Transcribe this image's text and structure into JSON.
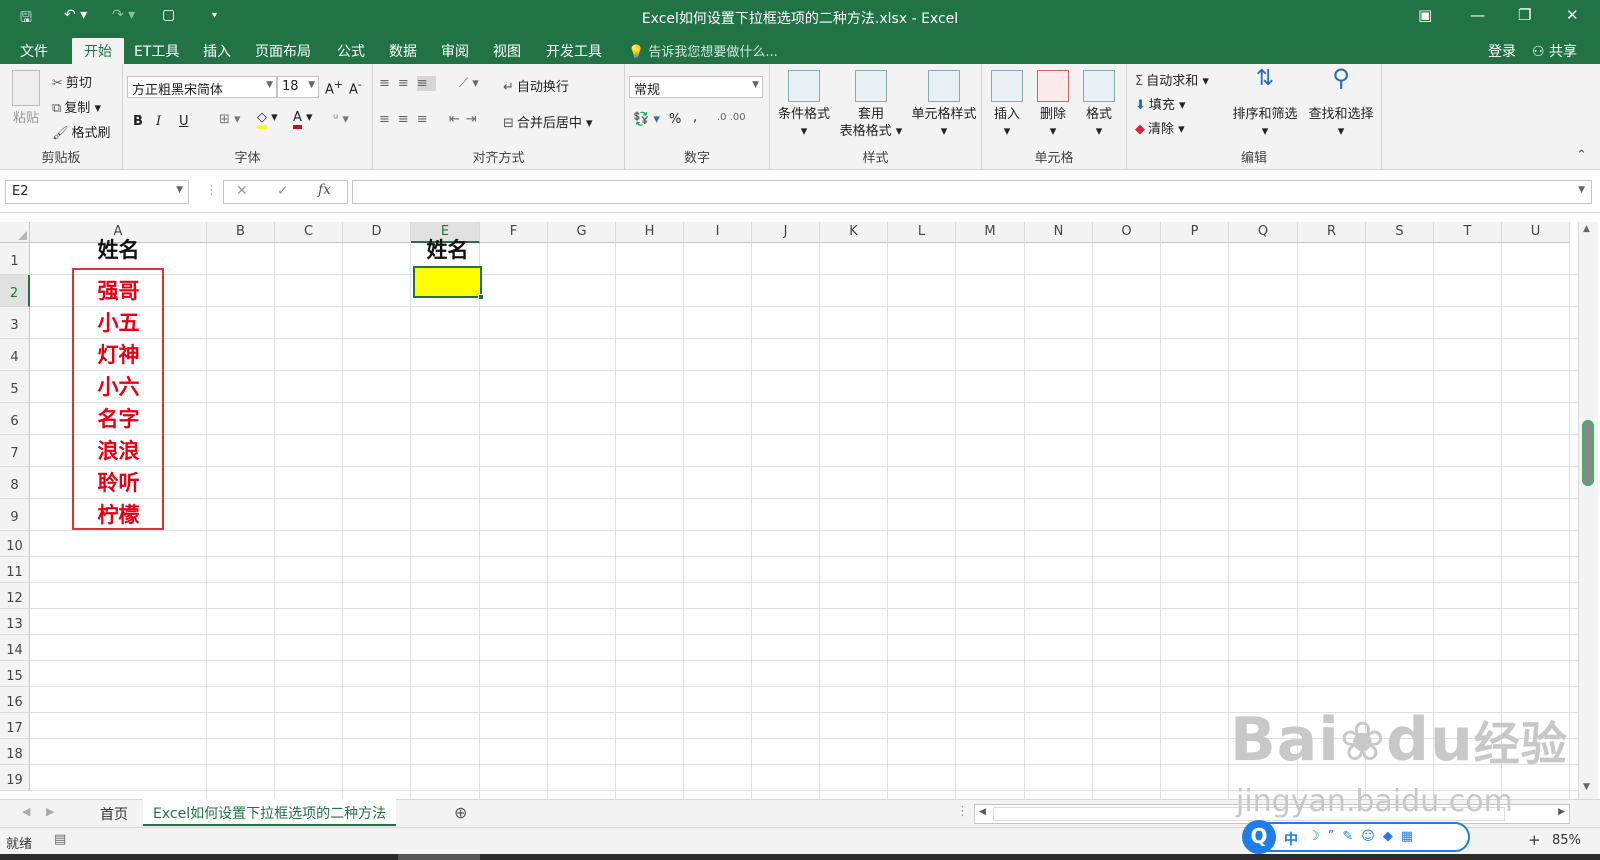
{
  "window": {
    "title": "Excel如何设置下拉框选项的二种方法.xlsx - Excel"
  },
  "menu": {
    "items": [
      "文件",
      "开始",
      "ET工具",
      "插入",
      "页面布局",
      "公式",
      "数据",
      "审阅",
      "视图",
      "开发工具"
    ],
    "active": "开始",
    "tell_me": "告诉我您想要做什么...",
    "login": "登录",
    "share": "共享"
  },
  "ribbon": {
    "clipboard": {
      "paste": "粘贴",
      "cut": "剪切",
      "copy": "复制",
      "format_painter": "格式刷",
      "label": "剪贴板"
    },
    "font": {
      "name": "方正粗黑宋简体",
      "size": "18",
      "bold": "B",
      "italic": "I",
      "underline": "U",
      "label": "字体"
    },
    "alignment": {
      "wrap": "自动换行",
      "merge": "合并后居中",
      "label": "对齐方式"
    },
    "number": {
      "format": "常规",
      "percent": "%",
      "comma": ",",
      "label": "数字"
    },
    "styles": {
      "conditional": "条件格式",
      "table_line1": "套用",
      "table_line2": "表格格式",
      "cell_styles": "单元格样式",
      "label": "样式"
    },
    "cells": {
      "insert": "插入",
      "delete": "删除",
      "format": "格式",
      "label": "单元格"
    },
    "editing": {
      "autosum": "自动求和",
      "fill": "填充",
      "clear": "清除",
      "sort": "排序和筛选",
      "find": "查找和选择",
      "label": "编辑"
    }
  },
  "formula_bar": {
    "name_box": "E2",
    "fx": "fx",
    "value": ""
  },
  "grid": {
    "columns": [
      "A",
      "B",
      "C",
      "D",
      "E",
      "F",
      "G",
      "H",
      "I",
      "J",
      "K",
      "L",
      "M",
      "N",
      "O",
      "P",
      "Q",
      "R",
      "S",
      "T",
      "U"
    ],
    "rows": [
      "1",
      "2",
      "3",
      "4",
      "5",
      "6",
      "7",
      "8",
      "9",
      "10",
      "11",
      "12",
      "13",
      "14",
      "15",
      "16",
      "17",
      "18",
      "19"
    ],
    "selected_cell": "E2",
    "header_a1": "姓名",
    "header_e1": "姓名",
    "names": [
      "强哥",
      "小五",
      "灯神",
      "小六",
      "名字",
      "浪浪",
      "聆听",
      "柠檬"
    ],
    "name_color": "#e60012",
    "highlight_color": "#ffff00",
    "border_color": "#d9343a"
  },
  "sheets": {
    "tabs": [
      "首页",
      "Excel如何设置下拉框选项的二种方法"
    ],
    "active_index": 1
  },
  "status": {
    "ready": "就绪",
    "zoom": "85%"
  },
  "watermark": {
    "brand_a": "Bai",
    "brand_b": "du",
    "brand_c": "经验",
    "url": "jingyan.baidu.com"
  },
  "ime": {
    "label": "中"
  }
}
